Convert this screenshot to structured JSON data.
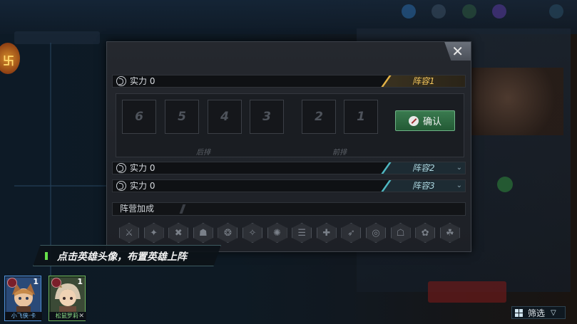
{
  "modal": {
    "close_label": "✕",
    "lineups": [
      {
        "power_label": "实力 0",
        "tag": "阵容1",
        "active": true,
        "chevron": ""
      },
      {
        "power_label": "实力 0",
        "tag": "阵容2",
        "active": false,
        "chevron": "⌄"
      },
      {
        "power_label": "实力 0",
        "tag": "阵容3",
        "active": false,
        "chevron": "⌄"
      }
    ],
    "slots": [
      "6",
      "5",
      "4",
      "3",
      "2",
      "1"
    ],
    "back_row_label": "后排",
    "front_row_label": "前排",
    "confirm_label": "确认",
    "camp_bonus_label": "阵营加成",
    "camp_icons": [
      "faction-icon-1",
      "faction-icon-2",
      "faction-icon-3",
      "faction-icon-4",
      "faction-icon-5",
      "faction-icon-6",
      "faction-icon-7",
      "faction-icon-8",
      "faction-icon-9",
      "faction-icon-10",
      "faction-icon-11",
      "faction-icon-12",
      "faction-icon-13",
      "faction-icon-14"
    ]
  },
  "hint": {
    "text": "点击英雄头像，布置英雄上阵"
  },
  "heroes": [
    {
      "name": "小飞侠·卡",
      "level": "1",
      "name_color": "#7fc4ff"
    },
    {
      "name": "松鼠罗莉·",
      "level": "1",
      "name_color": "#8fe08a"
    }
  ],
  "filter": {
    "label": "筛选",
    "chevron": "▽"
  },
  "background": {
    "badge_glyph": "卐"
  },
  "colors": {
    "active_tag": "#f0c35a",
    "inactive_stripe": "#4fb8c2",
    "confirm_green": "#2f6b43",
    "hint_mark": "#66e04a"
  }
}
